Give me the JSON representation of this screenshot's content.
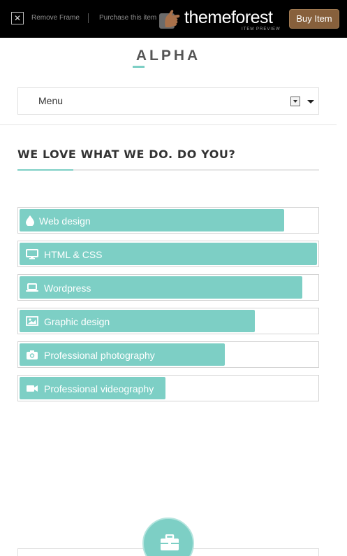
{
  "frame_bar": {
    "remove_frame": "Remove Frame",
    "purchase": "Purchase this item",
    "brand": "themeforest",
    "brand_sub": "ITEM PREVIEW",
    "buy": "Buy Item"
  },
  "site": {
    "logo": "ALPHA"
  },
  "nav": {
    "menu_label": "Menu"
  },
  "section": {
    "title": "WE LOVE WHAT WE DO. DO YOU?"
  },
  "skills": [
    {
      "label": "Web design",
      "icon": "droplet-icon",
      "level": 0.89
    },
    {
      "label": "HTML & CSS",
      "icon": "desktop-icon",
      "level": 1.0
    },
    {
      "label": "Wordpress",
      "icon": "laptop-icon",
      "level": 0.95
    },
    {
      "label": "Graphic design",
      "icon": "image-icon",
      "level": 0.79
    },
    {
      "label": "Professional photography",
      "icon": "camera-icon",
      "level": 0.69
    },
    {
      "label": "Professional videography",
      "icon": "video-camera-icon",
      "level": 0.49
    }
  ],
  "colors": {
    "accent": "#7dcfc5",
    "buy_button": "#87603c"
  },
  "next_section_icon": "briefcase-icon"
}
